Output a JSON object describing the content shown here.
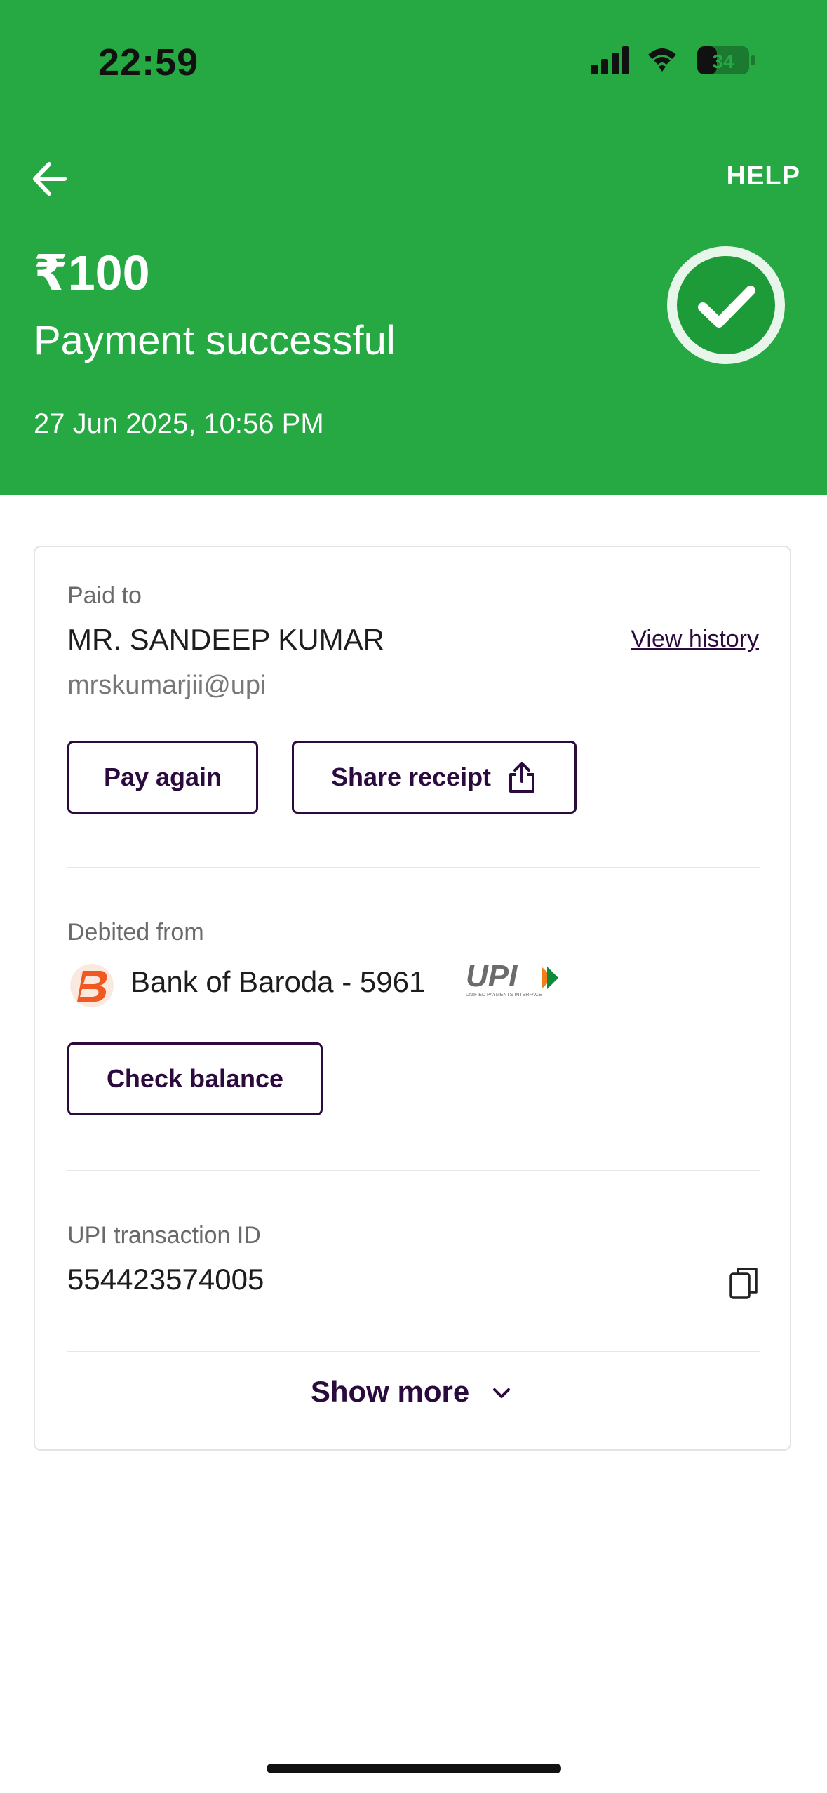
{
  "status_bar": {
    "time": "22:59",
    "battery": "34"
  },
  "header": {
    "help_label": "HELP",
    "amount": "₹100",
    "status": "Payment successful",
    "datetime": "27 Jun 2025, 10:56 PM",
    "background_color": "#26a843"
  },
  "paid_to": {
    "label": "Paid to",
    "name": "MR. SANDEEP  KUMAR",
    "upi_id": "mrskumarjii@upi",
    "view_history": "View history",
    "pay_again": "Pay again",
    "share_receipt": "Share receipt"
  },
  "debited_from": {
    "label": "Debited from",
    "account": "Bank of Baroda - 5961",
    "upi_logo_text": "UPI",
    "upi_logo_subtext": "UNIFIED PAYMENTS INTERFACE",
    "check_balance": "Check balance"
  },
  "transaction": {
    "label": "UPI transaction ID",
    "id": "554423574005"
  },
  "show_more": "Show more",
  "icons": {
    "back": "back-arrow-icon",
    "success": "checkmark-circle-icon",
    "share": "share-icon",
    "copy": "copy-icon",
    "chevron": "chevron-down-icon"
  }
}
